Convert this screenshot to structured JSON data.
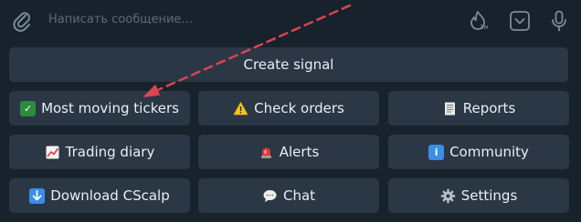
{
  "compose": {
    "placeholder": "Написать сообщение...",
    "timer_label": "1м",
    "icons": [
      "paperclip-icon",
      "flame-timer-icon",
      "bot-keyboard-icon",
      "microphone-icon"
    ]
  },
  "keyboard": {
    "create_signal": "Create signal",
    "most_moving": {
      "emoji": "💹",
      "label": "Most moving tickers"
    },
    "check_orders": {
      "emoji": "⚠️",
      "label": "Check orders"
    },
    "reports": {
      "emoji": "🧾",
      "label": "Reports"
    },
    "trading_diary": {
      "emoji": "📈",
      "label": "Trading diary"
    },
    "alerts": {
      "emoji": "🚨",
      "label": "Alerts"
    },
    "community": {
      "emoji": "ℹ️",
      "label": "Community"
    },
    "download": {
      "emoji": "⬇️",
      "label": "Download CScalp"
    },
    "chat": {
      "emoji": "💬",
      "label": "Chat"
    },
    "settings": {
      "emoji": "⚙️",
      "label": "Settings"
    }
  },
  "colors": {
    "background": "#18222d",
    "button": "#2b3745",
    "text": "#e9eef3",
    "placeholder": "#5b6b7a",
    "annotation_arrow": "#e0454f"
  }
}
